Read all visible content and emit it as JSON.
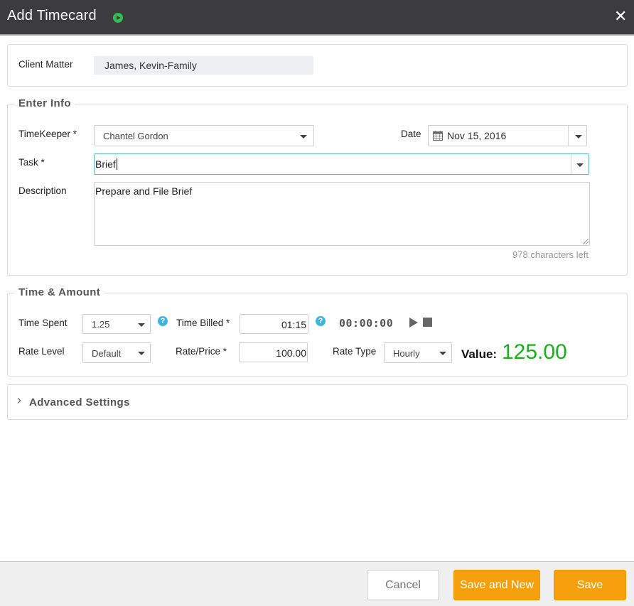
{
  "window": {
    "title": "Add Timecard",
    "close_glyph": "✕"
  },
  "client_matter": {
    "label": "Client Matter",
    "value": "James, Kevin-Family"
  },
  "enter_info": {
    "legend": "Enter Info",
    "timekeeper_label": "TimeKeeper *",
    "timekeeper_value": "Chantel Gordon",
    "date_label": "Date",
    "date_value": "Nov 15, 2016",
    "task_label": "Task *",
    "task_value": "Brief",
    "description_label": "Description",
    "description_value": "Prepare and File Brief",
    "chars_left": "978 characters left"
  },
  "time_amount": {
    "legend": "Time & Amount",
    "time_spent_label": "Time Spent",
    "time_spent_value": "1.25",
    "time_billed_label": "Time Billed *",
    "time_billed_value": "01:15",
    "timer_display": "00:00:00",
    "rate_level_label": "Rate Level",
    "rate_level_value": "Default",
    "rate_price_label": "Rate/Price *",
    "rate_price_value": "100.00",
    "rate_type_label": "Rate Type",
    "rate_type_value": "Hourly",
    "value_label": "Value:",
    "value_amount": "125.00",
    "help_glyph": "?"
  },
  "advanced": {
    "label": "Advanced Settings",
    "chevron": "›"
  },
  "footer": {
    "cancel": "Cancel",
    "save_and_new": "Save and New",
    "save": "Save"
  },
  "colors": {
    "title_bar": "#3c3c3e",
    "accent_orange": "#f5a00c",
    "value_green": "#17b217",
    "help_blue": "#3bb5e0",
    "play_green": "#2fbf55"
  },
  "icons": [
    "play-icon",
    "close-icon",
    "calendar-icon",
    "chevron-down-icon",
    "help-icon",
    "timer-play-icon",
    "timer-stop-icon",
    "chevron-right-icon"
  ]
}
